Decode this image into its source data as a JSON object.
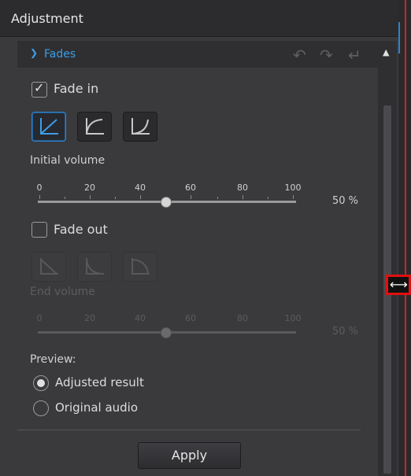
{
  "panel": {
    "title": "Adjustment"
  },
  "section": {
    "chevron_icon": "chevron-down-icon",
    "label": "Fades"
  },
  "toolbar": {
    "undo_icon": "undo-icon",
    "redo_icon": "redo-icon",
    "reset_icon": "reset-icon"
  },
  "fade_in": {
    "label": "Fade in",
    "checked": true,
    "shapes": [
      "linear",
      "logarithmic",
      "exponential"
    ],
    "selected_shape": "linear",
    "volume_label": "Initial volume",
    "ticks": [
      "0",
      "20",
      "40",
      "60",
      "80",
      "100"
    ],
    "value": 50,
    "value_text": "50 %"
  },
  "fade_out": {
    "label": "Fade out",
    "checked": false,
    "enabled": false,
    "shapes": [
      "linear",
      "logarithmic",
      "exponential"
    ],
    "volume_label": "End volume",
    "ticks": [
      "0",
      "20",
      "40",
      "60",
      "80",
      "100"
    ],
    "value": 50,
    "value_text": "50 %"
  },
  "preview": {
    "label": "Preview:",
    "options": [
      "Adjusted result",
      "Original audio"
    ],
    "selected": "Adjusted result"
  },
  "apply_label": "Apply",
  "colors": {
    "accent": "#3b9ee8",
    "panel": "#3a3a3d",
    "highlight": "#e10f0f"
  }
}
